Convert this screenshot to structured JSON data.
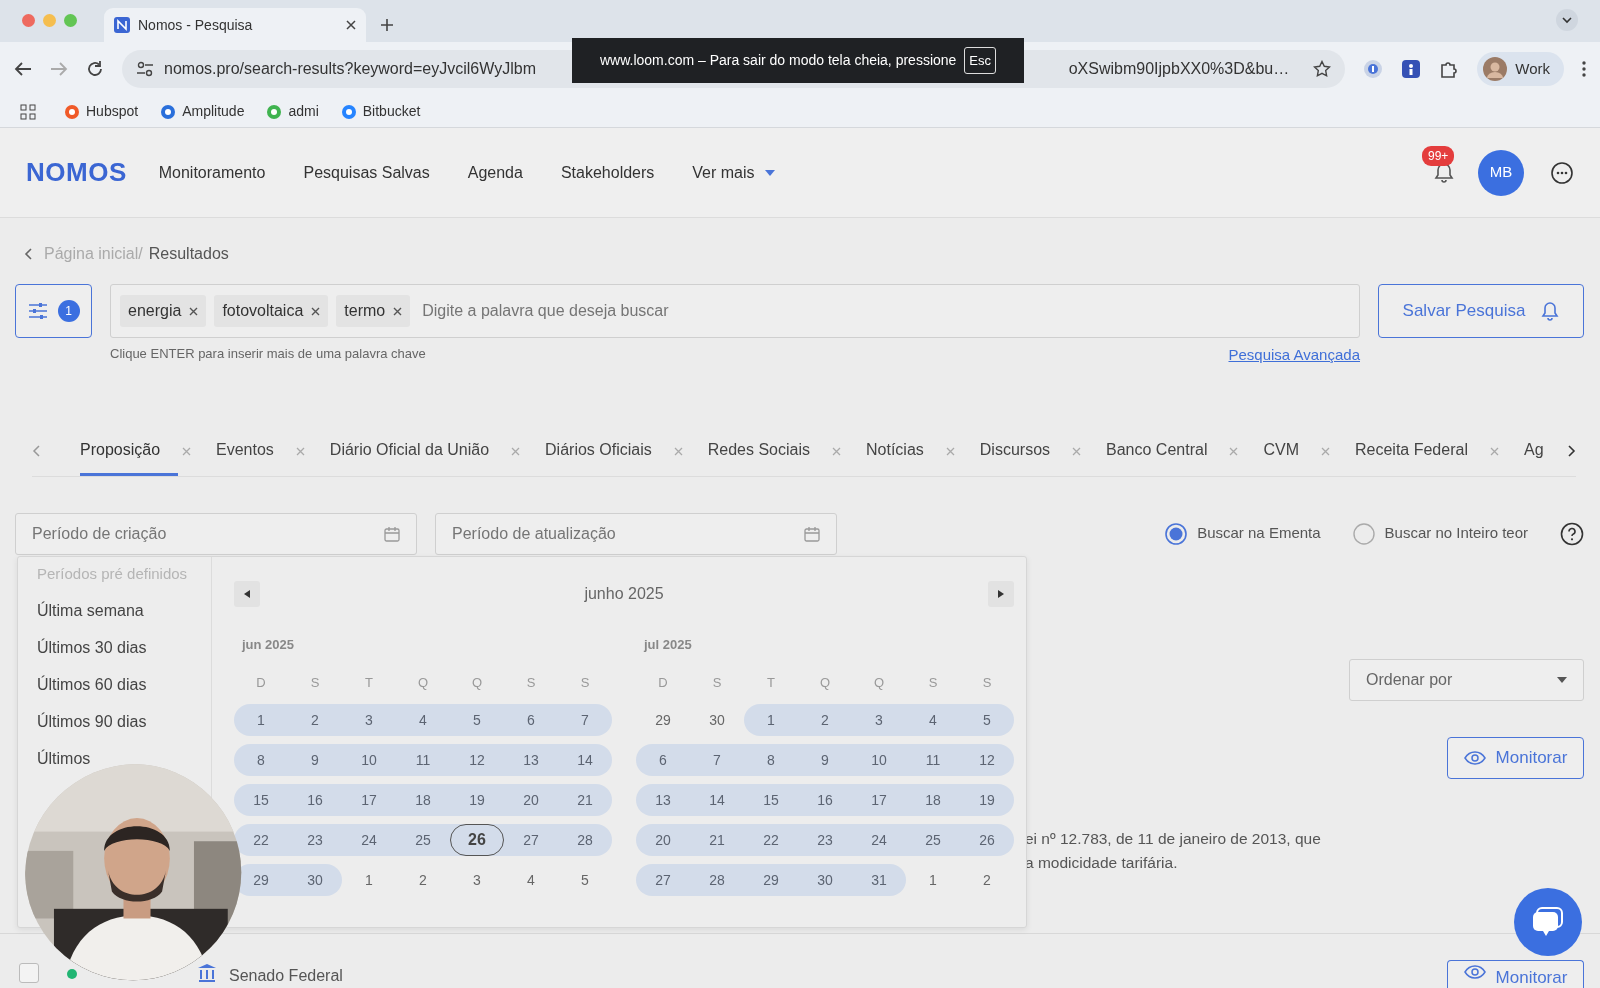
{
  "browser": {
    "tab_title": "Nomos - Pesquisa",
    "url_start": "nomos.pro/search-results?keyword=eyJvcil6WyJlbm",
    "url_end": "oXSwibm90IjpbXX0%3D&bu…",
    "profile": "Work",
    "bookmarks": [
      {
        "label": "Hubspot",
        "color": "#f05a28"
      },
      {
        "label": "Amplitude",
        "color": "#2a6fdb"
      },
      {
        "label": "admi",
        "color": "#3fb34f"
      },
      {
        "label": "Bitbucket",
        "color": "#2684ff"
      }
    ]
  },
  "fullscreen_notice": {
    "text": "www.loom.com – Para sair do modo tela cheia, pressione",
    "key": "Esc"
  },
  "app": {
    "logo": "NOMOS",
    "nav": [
      {
        "label": "Monitoramento",
        "kind": "link"
      },
      {
        "label": "Pesquisas Salvas",
        "kind": "link"
      },
      {
        "label": "Agenda",
        "kind": "link"
      },
      {
        "label": "Stakeholders",
        "kind": "link"
      },
      {
        "label": "Ver mais",
        "kind": "dropdown"
      }
    ],
    "notifications": "99+",
    "avatar": "MB"
  },
  "breadcrumb": [
    "Página inicial/",
    "Resultados"
  ],
  "search": {
    "filter_count": "1",
    "tags": [
      "energia",
      "fotovoltaica",
      "termo"
    ],
    "placeholder": "Digite a palavra que deseja buscar",
    "hint": "Clique ENTER para inserir mais de uma palavra chave",
    "advanced_link": "Pesquisa Avançada",
    "save_button": "Salvar Pesquisa"
  },
  "tabs": [
    {
      "label": "Proposição",
      "selected": true
    },
    {
      "label": "Eventos",
      "selected": false
    },
    {
      "label": "Diário Oficial da União",
      "selected": false
    },
    {
      "label": "Diários Oficiais",
      "selected": false
    },
    {
      "label": "Redes Sociais",
      "selected": false
    },
    {
      "label": "Notícias",
      "selected": false
    },
    {
      "label": "Discursos",
      "selected": false
    },
    {
      "label": "Banco Central",
      "selected": false
    },
    {
      "label": "CVM",
      "selected": false
    },
    {
      "label": "Receita Federal",
      "selected": false
    },
    {
      "label": "Ag",
      "selected": false
    }
  ],
  "filters": {
    "created_placeholder": "Período de criação",
    "updated_placeholder": "Período de atualização",
    "radios": [
      {
        "label": "Buscar na Ementa",
        "selected": true
      },
      {
        "label": "Buscar no Inteiro teor",
        "selected": false
      }
    ]
  },
  "sort": {
    "placeholder": "Ordenar por"
  },
  "date_picker": {
    "presets_title": "Períodos pré definidos",
    "presets": [
      "Última semana",
      "Últimos 30 dias",
      "Últimos 60 dias",
      "Últimos 90 dias",
      "Últimos"
    ],
    "header": "junho 2025",
    "months": [
      {
        "title": "jun 2025",
        "weekdays": [
          "D",
          "S",
          "T",
          "Q",
          "Q",
          "S",
          "S"
        ],
        "weeks": [
          [
            {
              "d": "1",
              "in_range": true,
              "today": false
            },
            {
              "d": "2",
              "in_range": true,
              "today": false
            },
            {
              "d": "3",
              "in_range": true,
              "today": false
            },
            {
              "d": "4",
              "in_range": true,
              "today": false
            },
            {
              "d": "5",
              "in_range": true,
              "today": false
            },
            {
              "d": "6",
              "in_range": true,
              "today": false
            },
            {
              "d": "7",
              "in_range": true,
              "today": false
            }
          ],
          [
            {
              "d": "8",
              "in_range": true,
              "today": false
            },
            {
              "d": "9",
              "in_range": true,
              "today": false
            },
            {
              "d": "10",
              "in_range": true,
              "today": false
            },
            {
              "d": "11",
              "in_range": true,
              "today": false
            },
            {
              "d": "12",
              "in_range": true,
              "today": false
            },
            {
              "d": "13",
              "in_range": true,
              "today": false
            },
            {
              "d": "14",
              "in_range": true,
              "today": false
            }
          ],
          [
            {
              "d": "15",
              "in_range": true,
              "today": false
            },
            {
              "d": "16",
              "in_range": true,
              "today": false
            },
            {
              "d": "17",
              "in_range": true,
              "today": false
            },
            {
              "d": "18",
              "in_range": true,
              "today": false
            },
            {
              "d": "19",
              "in_range": true,
              "today": false
            },
            {
              "d": "20",
              "in_range": true,
              "today": false
            },
            {
              "d": "21",
              "in_range": true,
              "today": false
            }
          ],
          [
            {
              "d": "22",
              "in_range": true,
              "today": false
            },
            {
              "d": "23",
              "in_range": true,
              "today": false
            },
            {
              "d": "24",
              "in_range": true,
              "today": false
            },
            {
              "d": "25",
              "in_range": true,
              "today": false
            },
            {
              "d": "26",
              "in_range": true,
              "today": true
            },
            {
              "d": "27",
              "in_range": true,
              "today": false
            },
            {
              "d": "28",
              "in_range": true,
              "today": false
            }
          ],
          [
            {
              "d": "29",
              "in_range": true,
              "today": false
            },
            {
              "d": "30",
              "in_range": true,
              "today": false
            },
            {
              "d": "1",
              "in_range": false,
              "today": false
            },
            {
              "d": "2",
              "in_range": false,
              "today": false
            },
            {
              "d": "3",
              "in_range": false,
              "today": false
            },
            {
              "d": "4",
              "in_range": false,
              "today": false
            },
            {
              "d": "5",
              "in_range": false,
              "today": false
            }
          ]
        ]
      },
      {
        "title": "jul 2025",
        "weekdays": [
          "D",
          "S",
          "T",
          "Q",
          "Q",
          "S",
          "S"
        ],
        "weeks": [
          [
            {
              "d": "29",
              "in_range": false,
              "today": false
            },
            {
              "d": "30",
              "in_range": false,
              "today": false
            },
            {
              "d": "1",
              "in_range": true,
              "today": false
            },
            {
              "d": "2",
              "in_range": true,
              "today": false
            },
            {
              "d": "3",
              "in_range": true,
              "today": false
            },
            {
              "d": "4",
              "in_range": true,
              "today": false
            },
            {
              "d": "5",
              "in_range": true,
              "today": false
            }
          ],
          [
            {
              "d": "6",
              "in_range": true,
              "today": false
            },
            {
              "d": "7",
              "in_range": true,
              "today": false
            },
            {
              "d": "8",
              "in_range": true,
              "today": false
            },
            {
              "d": "9",
              "in_range": true,
              "today": false
            },
            {
              "d": "10",
              "in_range": true,
              "today": false
            },
            {
              "d": "11",
              "in_range": true,
              "today": false
            },
            {
              "d": "12",
              "in_range": true,
              "today": false
            }
          ],
          [
            {
              "d": "13",
              "in_range": true,
              "today": false
            },
            {
              "d": "14",
              "in_range": true,
              "today": false
            },
            {
              "d": "15",
              "in_range": true,
              "today": false
            },
            {
              "d": "16",
              "in_range": true,
              "today": false
            },
            {
              "d": "17",
              "in_range": true,
              "today": false
            },
            {
              "d": "18",
              "in_range": true,
              "today": false
            },
            {
              "d": "19",
              "in_range": true,
              "today": false
            }
          ],
          [
            {
              "d": "20",
              "in_range": true,
              "today": false
            },
            {
              "d": "21",
              "in_range": true,
              "today": false
            },
            {
              "d": "22",
              "in_range": true,
              "today": false
            },
            {
              "d": "23",
              "in_range": true,
              "today": false
            },
            {
              "d": "24",
              "in_range": true,
              "today": false
            },
            {
              "d": "25",
              "in_range": true,
              "today": false
            },
            {
              "d": "26",
              "in_range": true,
              "today": false
            }
          ],
          [
            {
              "d": "27",
              "in_range": true,
              "today": false
            },
            {
              "d": "28",
              "in_range": true,
              "today": false
            },
            {
              "d": "29",
              "in_range": true,
              "today": false
            },
            {
              "d": "30",
              "in_range": true,
              "today": false
            },
            {
              "d": "31",
              "in_range": true,
              "today": false
            },
            {
              "d": "1",
              "in_range": false,
              "today": false
            },
            {
              "d": "2",
              "in_range": false,
              "today": false
            }
          ]
        ]
      }
    ]
  },
  "results": [
    {
      "text_lines": [
        "ei nº 12.783, de 11 de janeiro de 2013, que",
        "a modicidade tarifária."
      ],
      "monitor_button": "Monitorar"
    },
    {
      "selected": false,
      "source": "Senado Federal",
      "color": "#22b573",
      "monitor_button": "Monitorar"
    }
  ],
  "webcam": {
    "kind": "picture"
  }
}
